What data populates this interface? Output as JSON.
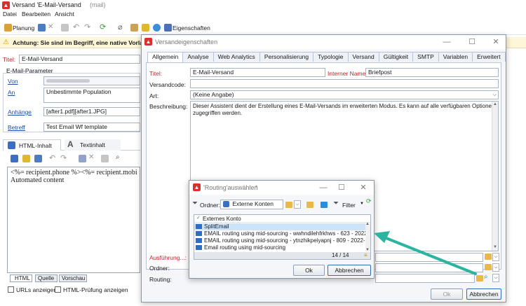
{
  "main": {
    "title": "Versand 'E-Mail-Versand",
    "title_suffix": "(mail)",
    "menu": [
      "Datei",
      "Bearbeiten",
      "Ansicht"
    ],
    "toolbar": {
      "planung": "Planung",
      "eigenschaften": "Eigenschaften"
    },
    "warning": "Achtung: Sie sind im Begriff, eine native Vorlag",
    "titel_label": "Titel:",
    "titel_value": "E-Mail-Versand",
    "params_header": "E-Mail-Parameter",
    "von_label": "Von",
    "an_label": "An",
    "an_value": "Unbestimmte Population",
    "anhaenge_label": "Anhänge",
    "anhaenge_value": "[after1.pdf][after1.JPG]",
    "betreff_label": "Betreff",
    "betreff_value": "Test Email Wf template",
    "content_tabs": [
      "HTML-Inhalt",
      "Textinhalt"
    ],
    "editor_lines": [
      "<%= recipient.phone %><%= recipient.mobi",
      "Automated content"
    ],
    "bottom_tabs": [
      "HTML",
      "Quelle",
      "Vorschau"
    ],
    "checkbox_urls": "URLs anzeigen",
    "checkbox_html": "HTML-Prüfung anzeigen"
  },
  "props": {
    "title": "Versandeigenschaften",
    "tabs": [
      "Allgemein",
      "Analyse",
      "Web Analytics",
      "Personalisierung",
      "Typologie",
      "Versand",
      "Gültigkeit",
      "SMTP",
      "Variablen",
      "Erweitert"
    ],
    "titel_label": "Titel:",
    "titel_value": "E-Mail-Versand",
    "interner_name_label": "Interner Name:",
    "interner_name_value": "Briefpost",
    "versandcode_label": "Versandcode:",
    "art_label": "Art:",
    "art_value": "(Keine Angabe)",
    "beschreibung_label": "Beschreibung:",
    "beschreibung_value": "Dieser Assistent dient der Erstellung eines E-Mail-Versands im erweiterten Modus. Es kann auf alle verfügbaren Optionen zugegriffen werden.",
    "ausfuehrung_label": "Ausführung...:",
    "ordner_label": "Ordner:",
    "routing_label": "Routing:",
    "ok": "Ok",
    "abbrechen": "Abbrechen"
  },
  "routing": {
    "title": "'Routing'auswählen",
    "title_suffix": "*",
    "ordner_label": "Ordner:",
    "ordner_value": "Externe Konten",
    "filter_label": "Filter",
    "column_header": "Externes Konto",
    "items": [
      "SplitEmail",
      "EMAIL routing using mid-sourcing - wwhndilehfrkhws - 623 - 2022...",
      "EMAIL routing using mid-sourcing - ytnzhikpeiyapnj - 809 - 2022-...",
      "Email routing using mid-sourcing"
    ],
    "count": "14 / 14",
    "ok": "Ok",
    "abbrechen": "Abbrechen"
  },
  "colors": {
    "accent_red": "#c0262d",
    "selection_blue": "#cde3f7",
    "arrow_teal": "#2bb5a0"
  }
}
